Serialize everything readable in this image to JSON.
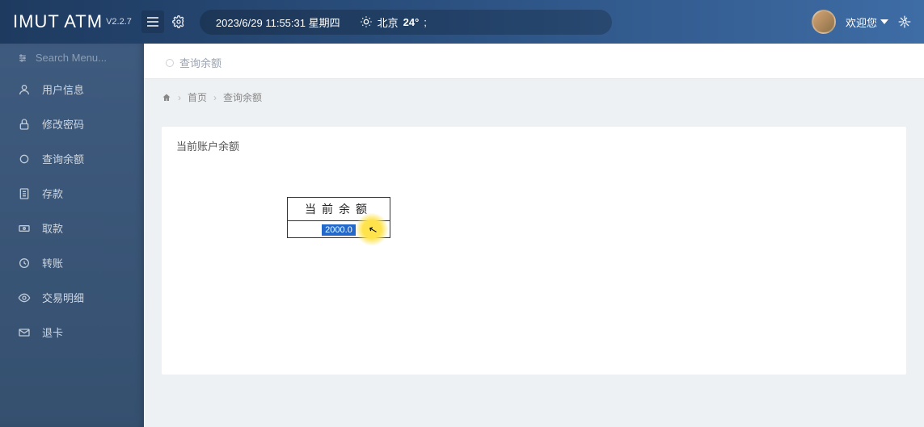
{
  "header": {
    "app_name": "IMUT ATM",
    "version": "V2.2.7",
    "datetime": "2023/6/29 11:55:31 星期四",
    "weather_city": "北京",
    "weather_temp": "24°",
    "weather_extra": ";",
    "welcome": "欢迎您"
  },
  "sidebar": {
    "search_placeholder": "Search Menu...",
    "items": [
      {
        "label": "用户信息"
      },
      {
        "label": "修改密码"
      },
      {
        "label": "查询余额"
      },
      {
        "label": "存款"
      },
      {
        "label": "取款"
      },
      {
        "label": "转账"
      },
      {
        "label": "交易明细"
      },
      {
        "label": "退卡"
      }
    ]
  },
  "tab": {
    "label": "查询余额"
  },
  "breadcrumb": {
    "home": "首页",
    "current": "查询余额"
  },
  "card": {
    "header": "当前账户余额",
    "balance_label": "当前余额",
    "balance_value": "2000.0"
  }
}
